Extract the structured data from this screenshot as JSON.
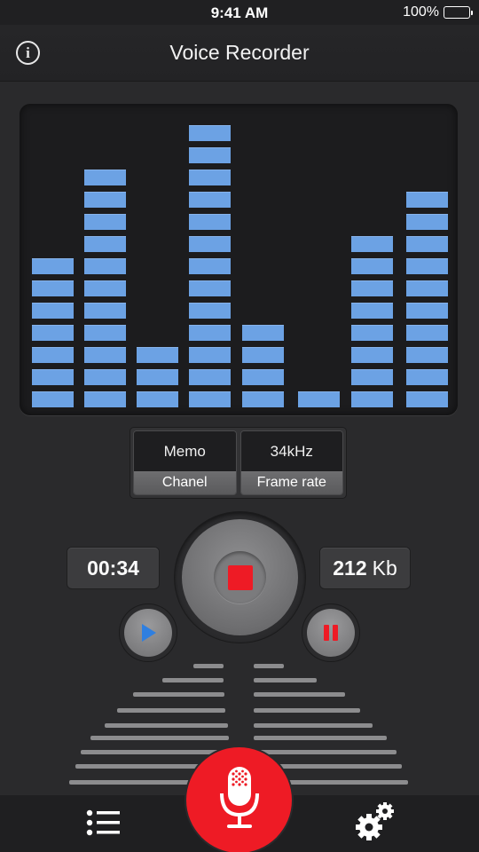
{
  "status_bar": {
    "time": "9:41 AM",
    "battery": "100%"
  },
  "nav": {
    "title": "Voice Recorder",
    "info_icon": "info-icon"
  },
  "visualizer": {
    "segment_color": "#6ca2e4",
    "levels": [
      7,
      11,
      3,
      13,
      4,
      1,
      8,
      10
    ]
  },
  "settings": {
    "channel": {
      "value": "Memo",
      "label": "Chanel"
    },
    "frame_rate": {
      "value": "34kHz",
      "label": "Frame rate"
    }
  },
  "recording": {
    "elapsed": "00:34",
    "size_value": "212",
    "size_unit": "Kb"
  },
  "controls": {
    "record_stop_icon": "stop-icon",
    "play_icon": "play-icon",
    "pause_icon": "pause-icon",
    "mic_icon": "microphone-icon",
    "list_icon": "list-icon",
    "settings_icon": "gear-icon"
  },
  "colors": {
    "accent_red": "#ee1b25",
    "accent_blue": "#2f7fe0",
    "background": "#2a2a2c"
  }
}
